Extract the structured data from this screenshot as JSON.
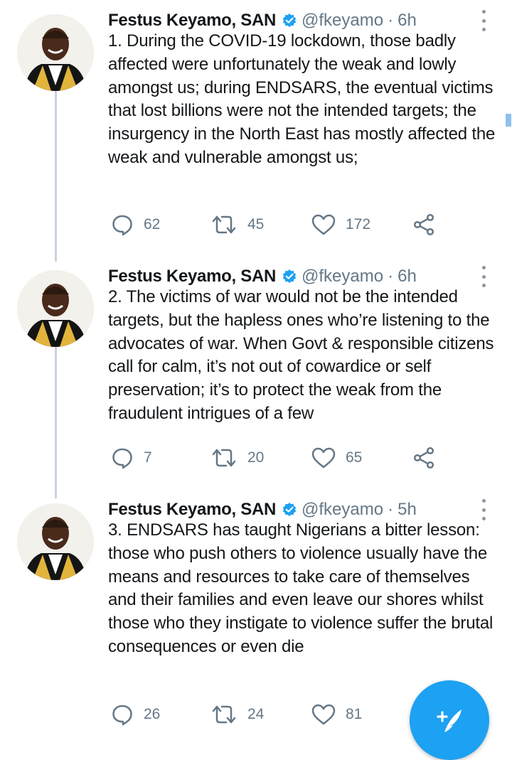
{
  "colors": {
    "accent": "#1da1f2",
    "text": "#14171a",
    "muted": "#657786",
    "thread_line": "#c9d3dc"
  },
  "tweets": [
    {
      "author_name": "Festus Keyamo, SAN",
      "handle": "@fkeyamo",
      "separator": "·",
      "time": "6h",
      "text": "1. During the COVID-19 lockdown, those badly affected were unfortunately the weak and lowly amongst us; during ENDSARS, the eventual victims that lost billions were not the intended targets; the insurgency in the North East has mostly affected the weak and vulnerable amongst us;",
      "replies": "62",
      "retweets": "45",
      "likes": "172"
    },
    {
      "author_name": "Festus Keyamo, SAN",
      "handle": "@fkeyamo",
      "separator": "·",
      "time": "6h",
      "text": "2. The victims of war would not be the intended targets, but the hapless ones who’re listening to the advocates of war. When Govt & responsible citizens call for calm, it’s not out of cowardice or self preservation; it’s to protect the weak from the fraudulent intrigues of a few",
      "replies": "7",
      "retweets": "20",
      "likes": "65"
    },
    {
      "author_name": "Festus Keyamo, SAN",
      "handle": "@fkeyamo",
      "separator": "·",
      "time": "5h",
      "text": "3. ENDSARS has taught Nigerians a bitter lesson: those who push others to violence usually have the means and resources to take care of themselves and their families and even leave our shores whilst those who they instigate to violence suffer the brutal consequences or even die",
      "replies": "26",
      "retweets": "24",
      "likes": "81"
    }
  ],
  "icons": {
    "reply": "reply-icon",
    "retweet": "retweet-icon",
    "like": "heart-icon",
    "share": "share-icon",
    "verified": "verified-badge-icon",
    "more": "more-vertical-icon",
    "compose": "compose-tweet-icon"
  }
}
